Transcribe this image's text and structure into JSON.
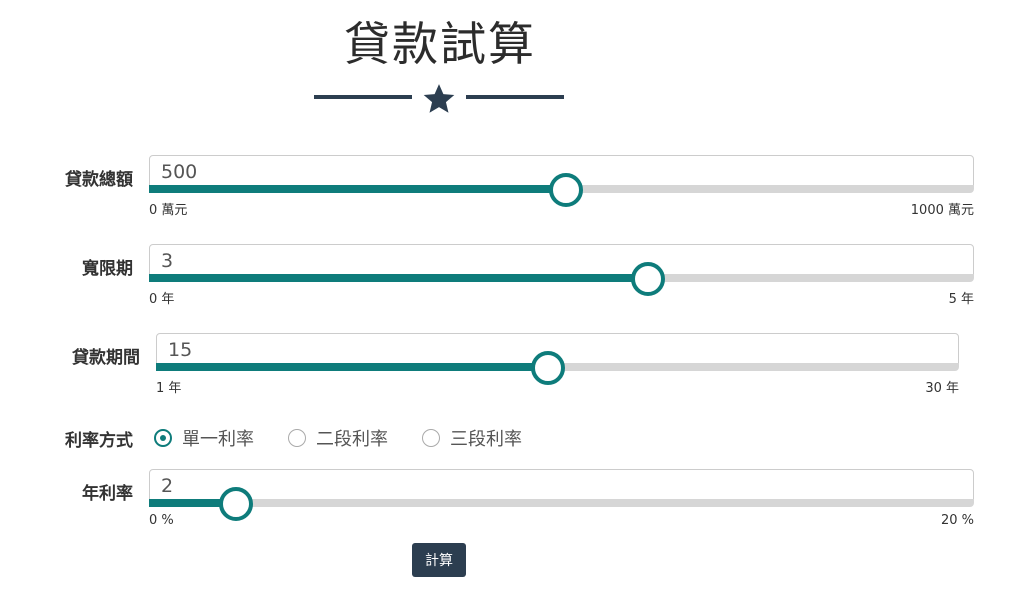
{
  "header": {
    "title": "貸款試算",
    "star_icon": "star-icon",
    "accent": "#2c3e50"
  },
  "form": {
    "loan_amount": {
      "label": "貸款總額",
      "value": "500",
      "min_label": "0 萬元",
      "max_label": "1000 萬元",
      "fraction": 0.5
    },
    "grace_period": {
      "label": "寬限期",
      "value": "3",
      "min_label": "0 年",
      "max_label": "5 年",
      "fraction": 0.6
    },
    "loan_term": {
      "label": "貸款期間",
      "value": "15",
      "min_label": "1 年",
      "max_label": "30 年",
      "fraction": 0.4828
    },
    "rate_mode": {
      "label": "利率方式",
      "options": [
        "單一利率",
        "二段利率",
        "三段利率"
      ],
      "selected": 0
    },
    "annual_rate": {
      "label": "年利率",
      "value": "2",
      "min_label": "0 %",
      "max_label": "20 %",
      "fraction": 0.1
    },
    "calc_label": "計算"
  },
  "colors": {
    "fill": "#0e7c7b",
    "track": "#d6d6d6"
  }
}
